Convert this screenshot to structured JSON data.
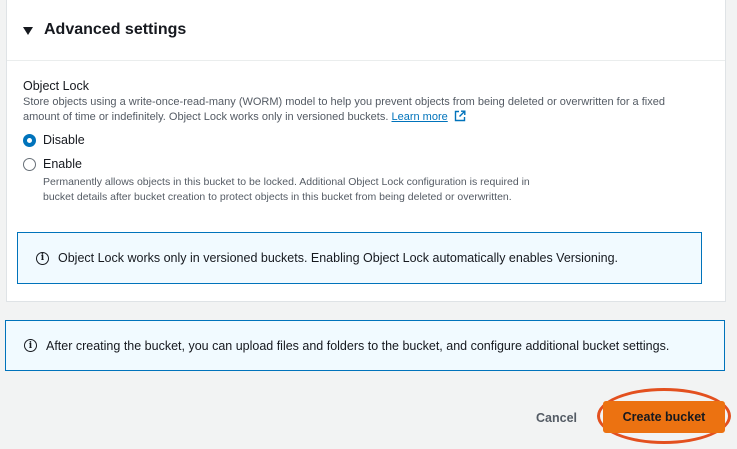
{
  "advanced": {
    "title": "Advanced settings",
    "object_lock_label": "Object Lock",
    "object_lock_desc": "Store objects using a write-once-read-many (WORM) model to help you prevent objects from being deleted or overwritten for a fixed amount of time or indefinitely. Object Lock works only in versioned buckets.",
    "learn_more": "Learn more",
    "options": [
      {
        "label": "Disable",
        "selected": true
      },
      {
        "label": "Enable",
        "selected": false,
        "desc": "Permanently allows objects in this bucket to be locked. Additional Object Lock configuration is required in bucket details after bucket creation to protect objects in this bucket from being deleted or overwritten."
      }
    ],
    "info": "Object Lock works only in versioned buckets. Enabling Object Lock automatically enables Versioning."
  },
  "footer_info": "After creating the bucket, you can upload files and folders to the bucket, and configure additional bucket settings.",
  "actions": {
    "cancel": "Cancel",
    "create": "Create bucket"
  },
  "colors": {
    "accent": "#0073bb",
    "primary_button": "#ec7211",
    "highlight_ring": "#e3501f"
  }
}
